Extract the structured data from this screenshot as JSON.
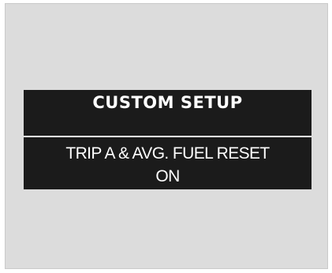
{
  "display": {
    "title": "CUSTOM SETUP",
    "setting_name": "TRIP A & AVG. FUEL RESET",
    "setting_value": "ON"
  },
  "colors": {
    "screen_background": "#1b1b1b",
    "frame_background": "#dcdcdc",
    "text": "#ffffff"
  }
}
